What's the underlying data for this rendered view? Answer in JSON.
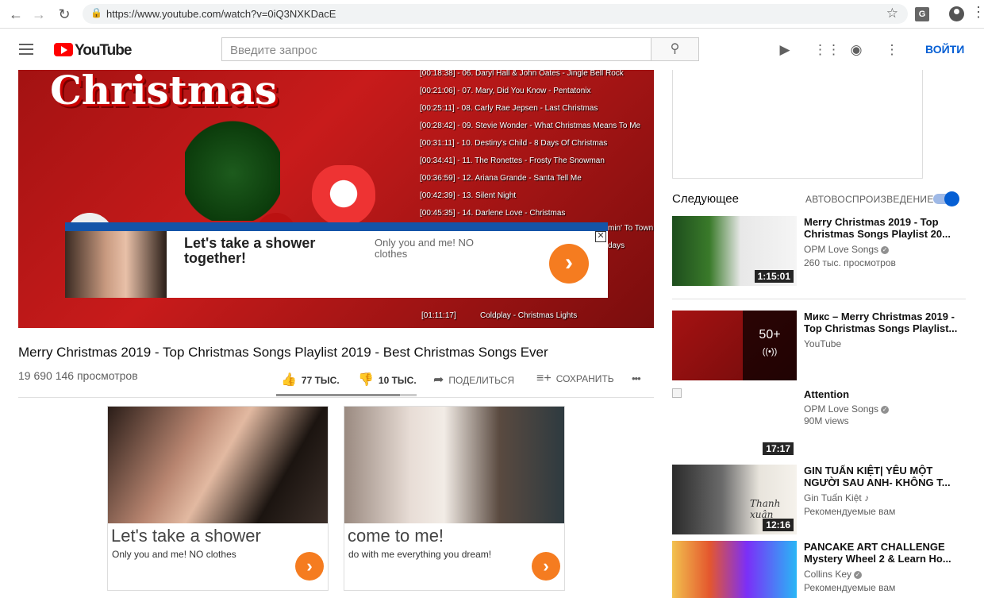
{
  "browser": {
    "url": "https://www.youtube.com/watch?v=0iQ3NXKDacE",
    "extension_letter": "G"
  },
  "youtube": {
    "logo_text": "YouTube",
    "search_placeholder": "Введите запрос",
    "login_label": "ВОЙТИ"
  },
  "player": {
    "title_art": "Christmas",
    "tracks": [
      "[00:18:38] - 06. Daryl Hall & John Oates - Jingle Bell Rock",
      "[00:21:06] - 07. Mary, Did You Know - Pentatonix",
      "[00:25:11] - 08. Carly Rae Jepsen - Last Christmas",
      "[00:28:42] - 09. Stevie Wonder - What Christmas Means To Me",
      "[00:31:11] - 10. Destiny's Child - 8 Days Of Christmas",
      "[00:34:41] - 11. The Ronettes - Frosty The Snowman",
      "[00:36:59] - 12. Ariana Grande - Santa Tell Me",
      "[00:42:39] - 13. Silent Night",
      "[00:45:35] - 14. Darlene Love - Christmas"
    ],
    "partial_right_1": "min' To Town",
    "partial_right_2": "days",
    "partial_bottom_a": "[01:11:17]",
    "partial_bottom_b": "Coldplay - Christmas Lights"
  },
  "overlay_ad": {
    "headline": "Let's take a shower together!",
    "text": "Only you and me! NO clothes",
    "arrow": "›",
    "close": "✕"
  },
  "video": {
    "title": "Merry Christmas 2019 - Top Christmas Songs Playlist 2019 - Best Christmas Songs Ever",
    "views": "19 690 146 просмотров",
    "likes": "77 ТЫС.",
    "dislikes": "10 ТЫС.",
    "share": "ПОДЕЛИТЬСЯ",
    "save": "СОХРАНИТЬ",
    "more": "•••",
    "like_ratio": 0.88
  },
  "bottom_ads": [
    {
      "headline": "Let's take a shower",
      "text": "Only you and me! NO clothes",
      "arrow": "›"
    },
    {
      "headline": "come to me!",
      "text": "do with me everything you dream!",
      "arrow": "›"
    }
  ],
  "sidebar": {
    "up_next": "Следующее",
    "autoplay": "АВТОВОСПРОИЗВЕДЕНИЕ",
    "autoplay_on": true,
    "recs": [
      {
        "title": "Merry Christmas 2019 - Top Christmas Songs Playlist 20...",
        "channel": "OPM Love Songs",
        "meta": "260 тыс. просмотров",
        "duration": "1:15:01",
        "verified": true
      },
      {
        "title": "Микс – Merry Christmas 2019 - Top Christmas Songs Playlist...",
        "channel": "YouTube",
        "meta": "",
        "overlay_count": "50+",
        "overlay_icon": "((•))"
      },
      {
        "title": "Attention",
        "channel": "OPM Love Songs",
        "meta": "90M views",
        "duration": "17:17",
        "verified": true
      },
      {
        "title": "GIN TUẤN KIỆT| YÊU MỘT NGƯỜI SAU ANH- KHÔNG T...",
        "channel": "Gin Tuấn Kiệt",
        "meta": "Рекомендуемые вам",
        "duration": "12:16",
        "thumb_caption": "Thanh xuân"
      },
      {
        "title": "PANCAKE ART CHALLENGE Mystery Wheel 2 & Learn Ho...",
        "channel": "Collins Key",
        "meta": "Рекомендуемые вам",
        "verified": true
      }
    ]
  },
  "colors": {
    "youtube_red": "#ff0000",
    "link_blue": "#065fd4",
    "ad_orange": "#f57c20",
    "player_red": "#c81b1b"
  }
}
